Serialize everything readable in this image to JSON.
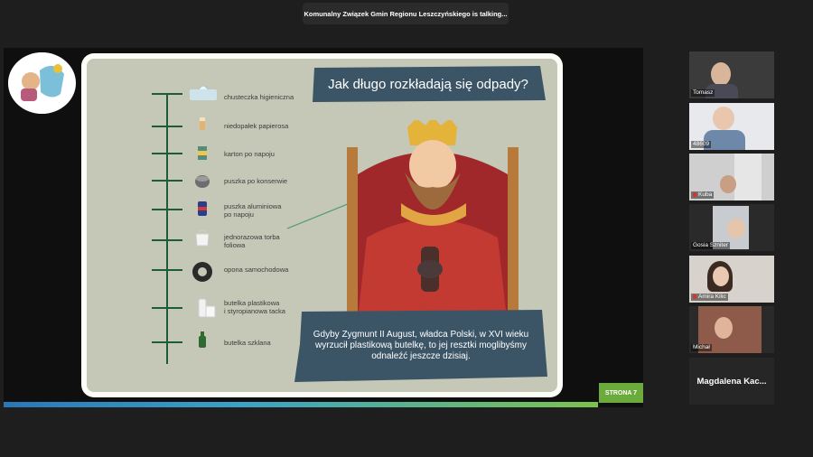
{
  "meeting": {
    "talking_indicator": "Komunalny Związek Gmin Regionu Leszczyńskiego is talking..."
  },
  "slide": {
    "title": "Jak długo rozkładają się odpady?",
    "caption": "Gdyby Zygmunt II August, władca Polski, w XVI wieku wyrzucił plastikową butelkę, to jej resztki moglibyśmy odnaleźć jeszcze dzisiaj.",
    "page_label": "STRONA 7",
    "items": [
      {
        "label": "chusteczka higieniczna",
        "icon": "tissue-icon"
      },
      {
        "label": "niedopałek papierosa",
        "icon": "cigarette-butt-icon"
      },
      {
        "label": "karton po napoju",
        "icon": "drink-carton-icon"
      },
      {
        "label": "puszka po konserwie",
        "icon": "tin-can-icon"
      },
      {
        "label": "puszka aluminiowa\npo napoju",
        "icon": "aluminium-can-icon"
      },
      {
        "label": "jednorazowa torba\nfoliowa",
        "icon": "plastic-bag-icon"
      },
      {
        "label": "opona samochodowa",
        "icon": "tyre-icon"
      },
      {
        "label": "butelka plastikowa\ni styropianowa tacka",
        "icon": "plastic-bottle-icon"
      },
      {
        "label": "butelka szklana",
        "icon": "glass-bottle-icon"
      }
    ]
  },
  "participants": [
    {
      "name": "Tomasz",
      "muted": false
    },
    {
      "name": "48609",
      "muted": false
    },
    {
      "name": "Kuba",
      "muted": true
    },
    {
      "name": "Gosia Szniter",
      "muted": false
    },
    {
      "name": "Amira Kilic",
      "muted": true
    },
    {
      "name": "Michał",
      "muted": false
    },
    {
      "name": "Magdalena Kac...",
      "muted": false,
      "video": false
    }
  ],
  "colors": {
    "slide_bg": "#c5c7b7",
    "banner": "#3b5566",
    "timeline": "#1e5b3b",
    "page_badge": "#6aab3b"
  }
}
